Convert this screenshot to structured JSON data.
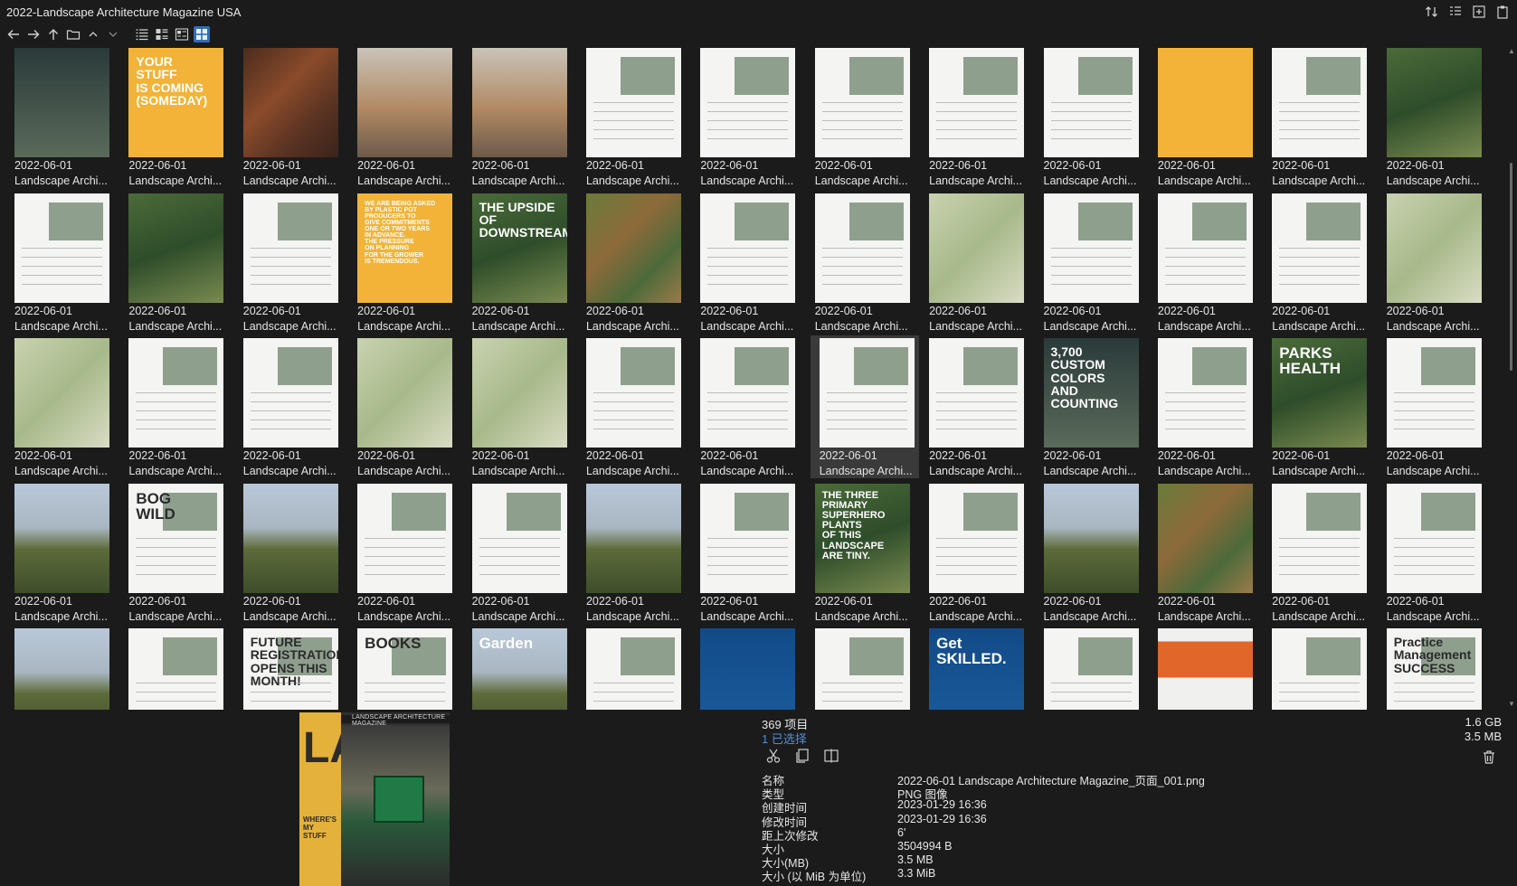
{
  "window": {
    "title": "2022-Landscape Architecture Magazine USA"
  },
  "titlebar_icons": [
    "sort-icon",
    "details-view-icon",
    "new-window-icon",
    "clipboard-icon"
  ],
  "toolbar": {
    "nav": [
      "back-icon",
      "forward-icon",
      "up-icon",
      "folder-icon",
      "chevron-up-icon",
      "chevron-down-icon"
    ],
    "views": [
      "list-view-icon",
      "small-icons-view-icon",
      "details-pane-view-icon",
      "large-icons-view-icon"
    ],
    "active_view": "large-icons-view-icon"
  },
  "grid": {
    "date_label": "2022-06-01",
    "name_label": "Landscape Archi...",
    "selected_index": 33,
    "tiles": [
      {
        "style": "t-dark",
        "text": ""
      },
      {
        "style": "t-yellow",
        "text": "YOUR\nSTUFF\nIS COMING\n(SOMEDAY)"
      },
      {
        "style": "t-rust",
        "text": ""
      },
      {
        "style": "t-ware",
        "text": ""
      },
      {
        "style": "t-ware",
        "text": ""
      },
      {
        "style": "t-white",
        "text": ""
      },
      {
        "style": "t-white",
        "text": ""
      },
      {
        "style": "t-white",
        "text": ""
      },
      {
        "style": "t-white",
        "text": ""
      },
      {
        "style": "t-white",
        "text": ""
      },
      {
        "style": "t-yellow",
        "text": ""
      },
      {
        "style": "t-white",
        "text": ""
      },
      {
        "style": "t-green",
        "text": ""
      },
      {
        "style": "t-white",
        "text": ""
      },
      {
        "style": "t-green",
        "text": ""
      },
      {
        "style": "t-white",
        "text": ""
      },
      {
        "style": "t-yellow",
        "text": "WE ARE BEING ASKED\nBY PLASTIC POT\nPRODUCERS TO\nGIVE COMMITMENTS\nONE OR TWO YEARS\nIN ADVANCE.\nTHE PRESSURE\nON PLANNING\nFOR THE GROWER\nIS TREMENDOUS."
      },
      {
        "style": "t-green",
        "text": "THE UPSIDE OF\nDOWNSTREAM"
      },
      {
        "style": "t-aerial",
        "text": ""
      },
      {
        "style": "t-white",
        "text": ""
      },
      {
        "style": "t-white",
        "text": ""
      },
      {
        "style": "t-map",
        "text": ""
      },
      {
        "style": "t-white",
        "text": ""
      },
      {
        "style": "t-white",
        "text": ""
      },
      {
        "style": "t-white",
        "text": ""
      },
      {
        "style": "t-map",
        "text": ""
      },
      {
        "style": "t-map",
        "text": ""
      },
      {
        "style": "t-white",
        "text": ""
      },
      {
        "style": "t-white",
        "text": ""
      },
      {
        "style": "t-map",
        "text": ""
      },
      {
        "style": "t-map",
        "text": ""
      },
      {
        "style": "t-white",
        "text": ""
      },
      {
        "style": "t-white",
        "text": ""
      },
      {
        "style": "t-white",
        "text": ""
      },
      {
        "style": "t-white",
        "text": ""
      },
      {
        "style": "t-dark",
        "text": "3,700\nCUSTOM COLORS\nAND COUNTING"
      },
      {
        "style": "t-white",
        "text": ""
      },
      {
        "style": "t-green",
        "text": "PARKS\nHEALTH"
      },
      {
        "style": "t-white",
        "text": ""
      },
      {
        "style": "t-sky",
        "text": ""
      },
      {
        "style": "t-white",
        "text": "BOG\nWILD"
      },
      {
        "style": "t-sky",
        "text": ""
      },
      {
        "style": "t-white",
        "text": ""
      },
      {
        "style": "t-white",
        "text": ""
      },
      {
        "style": "t-sky",
        "text": ""
      },
      {
        "style": "t-white",
        "text": ""
      },
      {
        "style": "t-green",
        "text": "THE THREE\nPRIMARY\nSUPERHERO\nPLANTS\nOF THIS\nLANDSCAPE\nARE TINY."
      },
      {
        "style": "t-white",
        "text": ""
      },
      {
        "style": "t-sky",
        "text": ""
      },
      {
        "style": "t-aerial",
        "text": ""
      },
      {
        "style": "t-white",
        "text": ""
      },
      {
        "style": "t-white",
        "text": ""
      },
      {
        "style": "t-sky",
        "text": ""
      },
      {
        "style": "t-white",
        "text": ""
      },
      {
        "style": "t-white",
        "text": "FUTURE\nREGISTRATION OPENS THIS MONTH!"
      },
      {
        "style": "t-white",
        "text": "BOOKS"
      },
      {
        "style": "t-sky",
        "text": "Garden"
      },
      {
        "style": "t-white",
        "text": ""
      },
      {
        "style": "t-blue",
        "text": ""
      },
      {
        "style": "t-white",
        "text": ""
      },
      {
        "style": "t-blue",
        "text": "Get SKILLED."
      },
      {
        "style": "t-white",
        "text": ""
      },
      {
        "style": "t-orange",
        "text": ""
      },
      {
        "style": "t-white",
        "text": ""
      },
      {
        "style": "t-white",
        "text": "Practice\nManagement\nSUCCESS"
      }
    ]
  },
  "details": {
    "item_count": "369 项目",
    "selected_count": "1 已选择",
    "total_size": "1.6 GB",
    "selected_size": "3.5 MB",
    "preview": {
      "header": "LANDSCAPE ARCHITECTURE MAGAZINE",
      "logo": "LAM",
      "headline": "WHERE'S MY\nSTUFF"
    },
    "actions": [
      "cut-icon",
      "copy-icon",
      "compare-icon"
    ],
    "properties": [
      {
        "key": "名称",
        "value": "2022-06-01 Landscape Architecture Magazine_页面_001.png"
      },
      {
        "key": "类型",
        "value": "PNG 图像"
      },
      {
        "key": "创建时间",
        "value": "2023-01-29  16:36"
      },
      {
        "key": "修改时间",
        "value": "2023-01-29  16:36"
      },
      {
        "key": "距上次修改",
        "value": "6'"
      },
      {
        "key": "大小",
        "value": "3504994 B"
      },
      {
        "key": "大小(MB)",
        "value": "3.5 MB"
      },
      {
        "key": "大小 (以 MiB 为单位)",
        "value": "3.3 MiB"
      }
    ]
  }
}
